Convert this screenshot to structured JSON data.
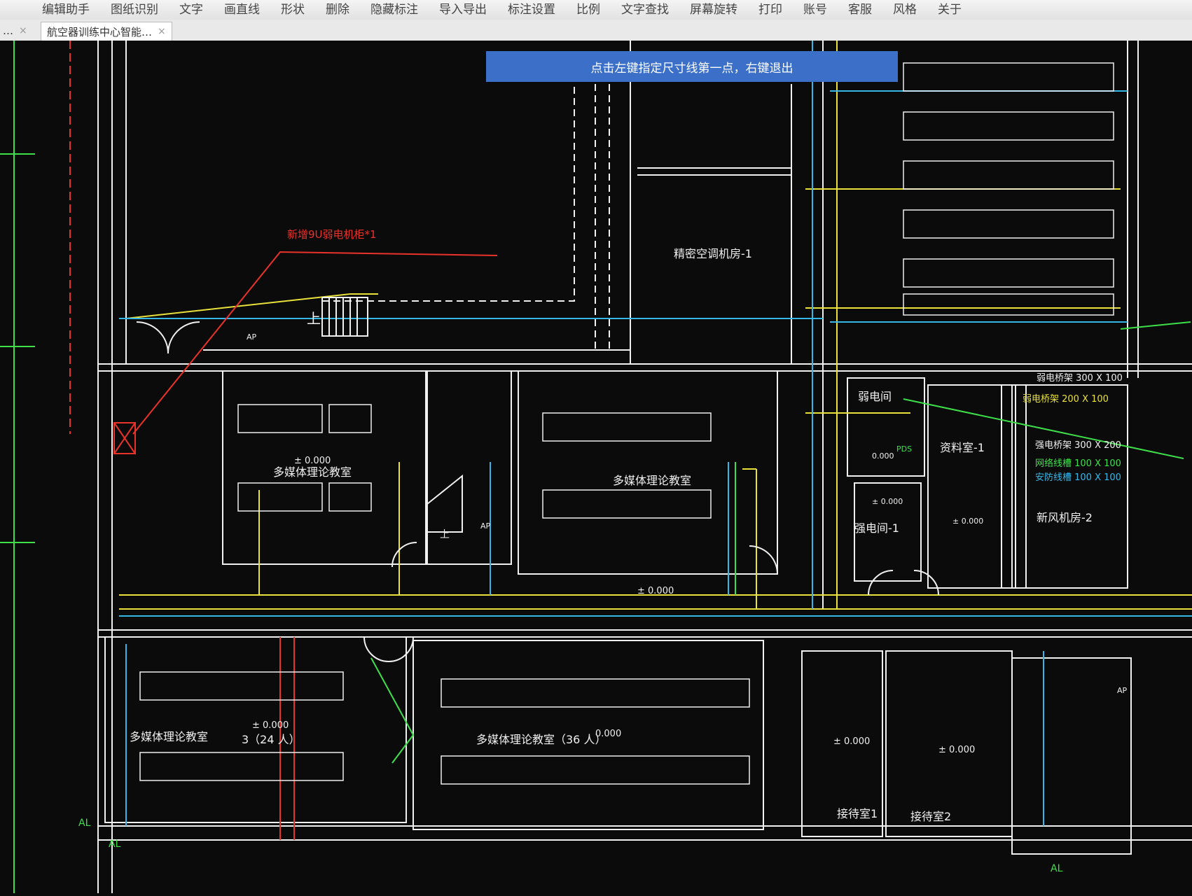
{
  "toolbar": {
    "items": [
      "编辑助手",
      "图纸识别",
      "文字",
      "画直线",
      "形状",
      "删除",
      "隐藏标注",
      "导入导出",
      "标注设置",
      "比例",
      "文字查找",
      "屏幕旋转",
      "打印",
      "账号",
      "客服",
      "风格",
      "关于"
    ]
  },
  "tabs": {
    "left_label": "…",
    "active_label": "航空器训练中心智能…",
    "close_symbol": "×"
  },
  "prompt": "点击左键指定尺寸线第一点，右键退出",
  "labels": {
    "new_cabinet": "新增9U弱电机柜*1",
    "ac_room": "精密空调机房-1",
    "classroom_a": "多媒体理论教室",
    "classroom_b": "多媒体理论教室",
    "classroom_c": "多媒体理论教室",
    "classroom_d": "多媒体理论教室（36 人）",
    "classroom_c_cap": "3（24 人）",
    "weak_room": "弱电间",
    "strong_room": "强电间-1",
    "archive": "资料室-1",
    "fresh_air": "新风机房-2",
    "reception1": "接待室1",
    "reception2": "接待室2",
    "elev_1": "± 0.000",
    "elev_2": "± 0.000",
    "elev_3": "± 0.000",
    "elev_4": "± 0.000",
    "elev_5": "± 0.000",
    "elev_6": "± 0.000",
    "elev_7": "± 0.000",
    "elev_8": "0.000",
    "elev_9": "0.000",
    "tray_1": "弱电桥架 300 X 100",
    "tray_2": "弱电桥架 200 X 100",
    "tray_3": "强电桥架 300 X 200",
    "tray_4": "网络线槽 100 X 100",
    "tray_5": "安防线槽 100 X 100",
    "pds": "PDS",
    "ap_1": "AP",
    "ap_2": "AP",
    "ap_3": "AP",
    "al_1": "AL",
    "al_2": "AL",
    "al_3": "AL",
    "up_1": "上",
    "up_2": "上"
  },
  "colors": {
    "wall": "#f0f0f0",
    "yellow": "#e8e23a",
    "cyan": "#35b8e8",
    "green": "#3ee04a",
    "red": "#e8322a",
    "canvas_bg": "#0b0b0c",
    "prompt_bg": "#3b6fc8"
  }
}
